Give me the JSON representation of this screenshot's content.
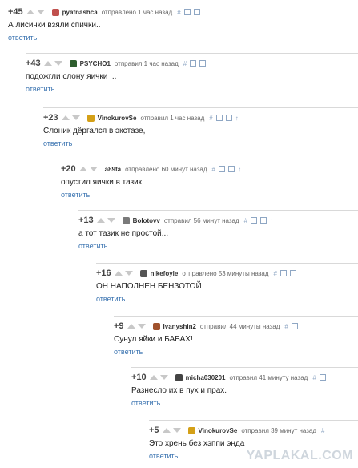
{
  "comments": [
    {
      "rating": "+45",
      "user": "pyatnashca",
      "time": "отправлено 1 час назад",
      "text": "А лисички взяли спички..",
      "reply": "ответить",
      "avatar_color": "#c0504d"
    },
    {
      "rating": "+43",
      "user": "PSYCHO1",
      "time": "отправил 1 час назад",
      "text": "подожгли слону яички ...",
      "reply": "ответить",
      "avatar_color": "#2e5e2e"
    },
    {
      "rating": "+23",
      "user": "VinokurovSe",
      "time": "отправил 1 час назад",
      "text": "Слоник дёргался в экстазе,",
      "reply": "ответить",
      "avatar_color": "#d4a017"
    },
    {
      "rating": "+20",
      "user": "a89fa",
      "time": "отправлено 60 минут назад",
      "text": "опустил яички в тазик.",
      "reply": "ответить",
      "avatar_color": "#9e9e9e"
    },
    {
      "rating": "+13",
      "user": "Bolotovv",
      "time": "отправил 56 минут назад",
      "text": "а тот тазик не простой...",
      "reply": "ответить",
      "avatar_color": "#7a7a7a"
    },
    {
      "rating": "+16",
      "user": "nikefoyle",
      "time": "отправлено 53 минуты назад",
      "text": "ОН НАПОЛНЕН БЕНЗОТОЙ",
      "reply": "ответить",
      "avatar_color": "#555555"
    },
    {
      "rating": "+9",
      "user": "Ivanyshin2",
      "time": "отправил 44 минуты назад",
      "text": "Сунул яйки и БАБАХ!",
      "reply": "ответить",
      "avatar_color": "#a0522d"
    },
    {
      "rating": "+10",
      "user": "micha030201",
      "time": "отправил 41 минуту назад",
      "text": "Разнесло их в пух и прах.",
      "reply": "ответить",
      "avatar_color": "#444444"
    },
    {
      "rating": "+5",
      "user": "VinokurovSe",
      "time": "отправил 39 минут назад",
      "text": "Это хрень без хэппи энда",
      "reply": "ответить",
      "avatar_color": "#d4a017"
    }
  ],
  "tools": {
    "hash": "#",
    "arrow": "↑"
  },
  "watermark": "YAPLAKAL.COM"
}
